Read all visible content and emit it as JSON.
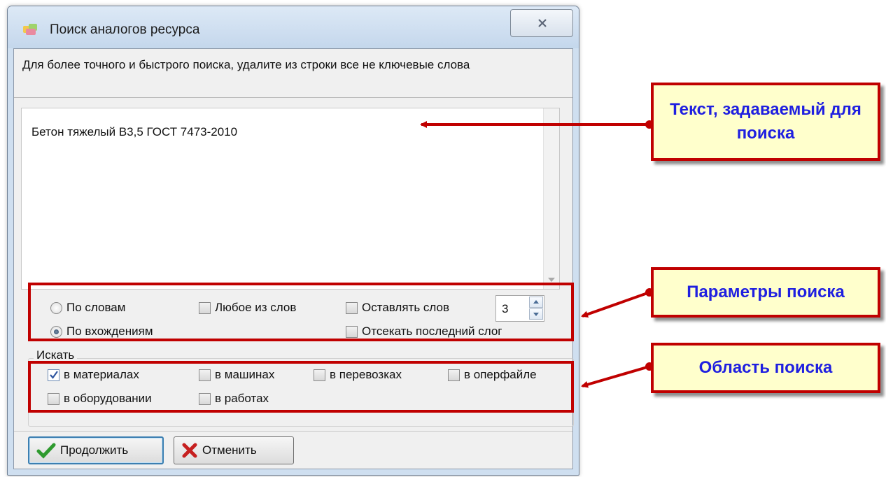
{
  "window": {
    "title": "Поиск аналогов ресурса",
    "hint": "Для более точного и быстрого поиска, удалите из строки все не ключевые слова",
    "query_text": "Бетон тяжелый В3,5 ГОСТ 7473-2010"
  },
  "params": {
    "radio_words": {
      "label": "По словам",
      "selected": false
    },
    "radio_occurrences": {
      "label": "По вхождениям",
      "selected": true
    },
    "any_word": {
      "label": "Любое из слов",
      "checked": false
    },
    "keep_words": {
      "label": "Оставлять слов",
      "checked": false,
      "value": "3"
    },
    "cut_last_syllable": {
      "label": "Отсекать последний слог",
      "checked": false
    }
  },
  "search_in": {
    "label": "Искать",
    "materials": {
      "label": "в материалах",
      "checked": true
    },
    "machines": {
      "label": "в машинах",
      "checked": false
    },
    "transport": {
      "label": "в перевозках",
      "checked": false
    },
    "operfile": {
      "label": "в оперфайле",
      "checked": false
    },
    "equipment": {
      "label": "в оборудовании",
      "checked": false
    },
    "works": {
      "label": "в работах",
      "checked": false
    }
  },
  "buttons": {
    "continue": "Продолжить",
    "cancel": "Отменить"
  },
  "annotations": {
    "search_text": "Текст, задаваемый для поиска",
    "search_params": "Параметры поиска",
    "search_area": "Область поиска"
  },
  "colors": {
    "annotation_border": "#c00000",
    "annotation_fill": "#ffffcc",
    "annotation_text": "#1f1fe0"
  }
}
